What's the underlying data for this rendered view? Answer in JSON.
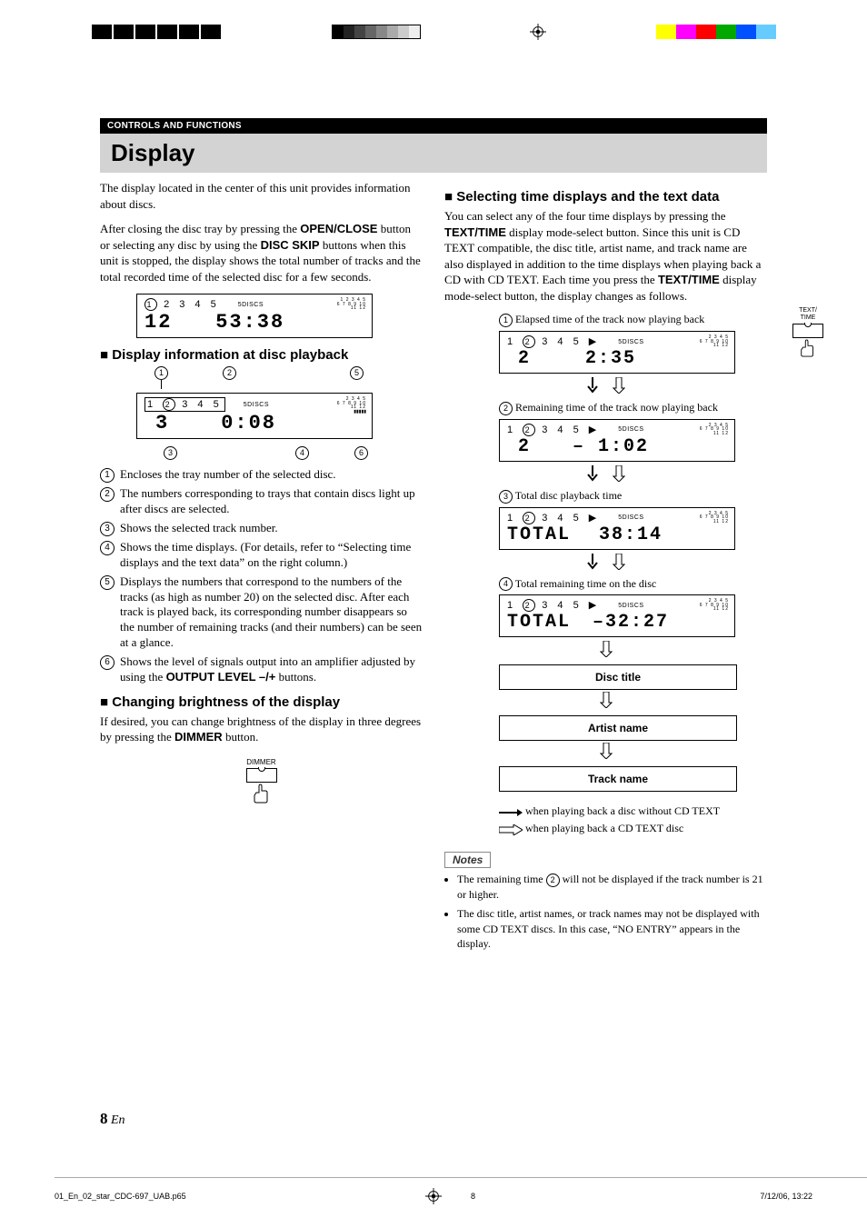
{
  "header_bar": "CONTROLS AND FUNCTIONS",
  "section_title": "Display",
  "left": {
    "intro": "The display located in the center of this unit provides information about discs.",
    "after_close_1": "After closing the disc tray by pressing the ",
    "open_close": "OPEN/CLOSE",
    "after_close_2": " button or selecting any disc by using the ",
    "disc_skip": "DISC SKIP",
    "after_close_3": " buttons when this unit is stopped, the display shows the total number of tracks and the total recorded time of the selected disc for a few seconds.",
    "lcd1": {
      "discs": "2 3 4 5",
      "selected": "1",
      "label": "5DISCS",
      "grid_top": "1 2 3 4 5",
      "grid_mid": "6 7 8 9 10",
      "grid_bot": "11 12",
      "tracks": "12",
      "time": "53:38"
    },
    "h1": "Display information at disc playback",
    "lcd2": {
      "discs_left": "1",
      "selected": "2",
      "discs_right": "3 4 5",
      "label": "5DISCS",
      "grid_top": "2 3 4 5",
      "grid_mid": "6 7 8 9 10",
      "grid_bot": "11 12",
      "track": "3",
      "time": "0:08"
    },
    "callout_1": "1",
    "callout_2": "2",
    "callout_3": "3",
    "callout_4": "4",
    "callout_5": "5",
    "callout_6": "6",
    "list": {
      "i1": "Encloses the tray number of the selected disc.",
      "i2": "The numbers corresponding to trays that contain discs light up after discs are selected.",
      "i3": "Shows the selected track number.",
      "i4a": "Shows the time displays. (For details, refer to “Selecting time displays and the text data” on the right column.)",
      "i5": "Displays the numbers that correspond to the numbers of the tracks (as high as number 20) on the selected disc. After each track is played back, its corresponding number disappears so the number of remaining tracks (and their numbers) can be seen at a glance.",
      "i6a": "Shows the level of signals output into an amplifier adjusted by using the ",
      "i6b": "OUTPUT LEVEL –/+",
      "i6c": " buttons."
    },
    "h2": "Changing brightness of the display",
    "bright_1": "If desired, you can change brightness of the display in three degrees by pressing the ",
    "bright_dimmer": "DIMMER",
    "bright_2": " button.",
    "dimmer_label": "DIMMER"
  },
  "right": {
    "h1": "Selecting time displays and the text data",
    "p1a": "You can select any of the four time displays by pressing the ",
    "p1_texttime": "TEXT/TIME",
    "p1b": " display mode-select button. Since this unit is CD TEXT compatible, the disc title, artist name, and track name are also displayed in addition to the time displays when playing back a CD with CD TEXT. Each time you press the ",
    "p1c": " display mode-select button, the display changes as follows.",
    "text_time_label": "TEXT/\nTIME",
    "steps": {
      "s1_label": "Elapsed time of the track now playing back",
      "s1_track": "2",
      "s1_time": "2:35",
      "s2_label": "Remaining time of the track now playing back",
      "s2_track": "2",
      "s2_time": "–  1:02",
      "s3_label": "Total disc playback time",
      "s3_main": "TOTAL",
      "s3_time": "38:14",
      "s4_label": "Total remaining time on the disc",
      "s4_main": "TOTAL",
      "s4_time": "–32:27",
      "discs_left": "1",
      "selected": "2",
      "discs_right": "3 4 5",
      "label": "5DISCS",
      "grid_top": "2 3 4 5",
      "grid_mid": "6 7 8 9 10",
      "grid_bot": "11 12",
      "disc_title": "Disc title",
      "artist_name": "Artist name",
      "track_name": "Track name"
    },
    "legend_solid": "when playing back a disc without CD TEXT",
    "legend_hollow": "when playing back a CD TEXT disc",
    "notes_title": "Notes",
    "note1a": "The remaining time ",
    "note1_num": "2",
    "note1b": " will not be displayed if the track number is 21 or higher.",
    "note2": "The disc title, artist names, or track names may not be displayed with some CD TEXT discs. In this case, “NO ENTRY” appears in the display."
  },
  "page_number_big": "8",
  "page_number_small": "En",
  "footer_left": "01_En_02_star_CDC-697_UAB.p65",
  "footer_center": "8",
  "footer_right": "7/12/06, 13:22"
}
